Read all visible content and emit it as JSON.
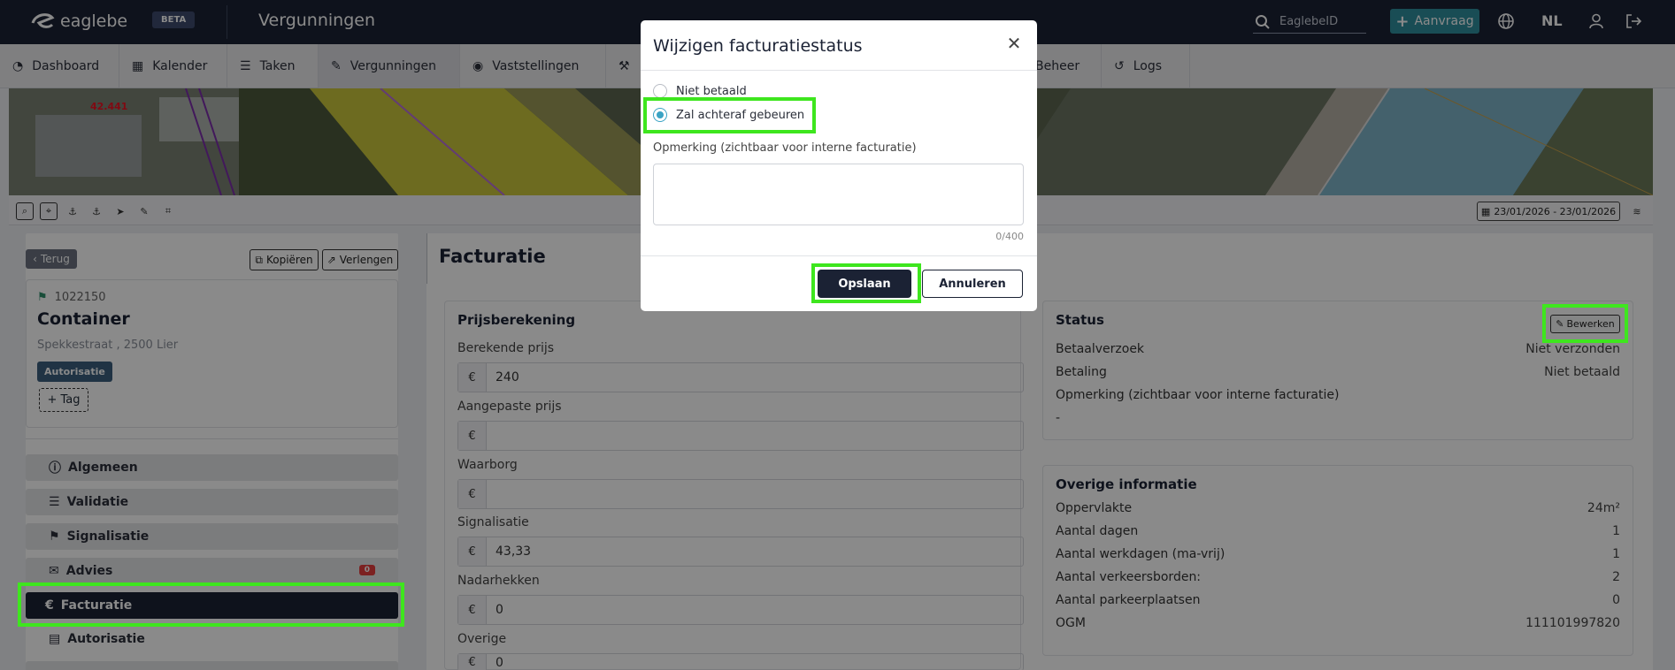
{
  "app": {
    "logo": "eaglebe",
    "beta": "BETA",
    "title": "Vergunningen"
  },
  "topbar": {
    "search_placeholder": "EaglebeID",
    "aanvraag_label": "Aanvraag",
    "language": "NL"
  },
  "nav": [
    {
      "label": "Dashboard"
    },
    {
      "label": "Kalender"
    },
    {
      "label": "Taken"
    },
    {
      "label": "Vergunningen"
    },
    {
      "label": "Vaststellingen"
    },
    {
      "label": "Beheer"
    },
    {
      "label": "Logs"
    }
  ],
  "map": {
    "label_speed": "42.441",
    "date_range": "23/01/2026 - 23/01/2026"
  },
  "left": {
    "back": "Terug",
    "copy": "Kopiëren",
    "extend": "Verlengen",
    "id": "1022150",
    "title": "Container",
    "address": "Spekkestraat , 2500 Lier",
    "badge": "Autorisatie",
    "tag": "+ Tag",
    "menu": [
      {
        "label": "Algemeen",
        "count": ""
      },
      {
        "label": "Validatie",
        "count": ""
      },
      {
        "label": "Signalisatie",
        "count": ""
      },
      {
        "label": "Advies",
        "count": "0"
      },
      {
        "label": "Facturatie",
        "count": ""
      },
      {
        "label": "Autorisatie",
        "count": ""
      }
    ]
  },
  "main": {
    "title": "Facturatie",
    "pricing": {
      "title": "Prijsberekening",
      "currency": "€",
      "fields": [
        {
          "label": "Berekende prijs",
          "value": "240"
        },
        {
          "label": "Aangepaste prijs",
          "value": ""
        },
        {
          "label": "Waarborg",
          "value": ""
        },
        {
          "label": "Signalisatie",
          "value": "43,33"
        },
        {
          "label": "Nadarhekken",
          "value": "0"
        },
        {
          "label": "Overige",
          "value": "0"
        }
      ]
    },
    "status": {
      "title": "Status",
      "edit": "Bewerken",
      "rows": [
        {
          "label": "Betaalverzoek",
          "value": "Niet verzonden"
        },
        {
          "label": "Betaling",
          "value": "Niet betaald"
        }
      ],
      "remark_label": "Opmerking (zichtbaar voor interne facturatie)",
      "remark_value": "-"
    },
    "info": {
      "title": "Overige informatie",
      "rows": [
        {
          "label": "Oppervlakte",
          "value": "24m²"
        },
        {
          "label": "Aantal dagen",
          "value": "1"
        },
        {
          "label": "Aantal werkdagen (ma-vrij)",
          "value": "1"
        },
        {
          "label": "Aantal verkeersborden:",
          "value": "2"
        },
        {
          "label": "Aantal parkeerplaatsen",
          "value": "0"
        },
        {
          "label": "OGM",
          "value": "111101997820"
        }
      ]
    }
  },
  "modal": {
    "title": "Wijzigen facturatiestatus",
    "options": [
      {
        "label": "Niet betaald",
        "selected": false
      },
      {
        "label": "Zal achteraf gebeuren",
        "selected": true
      }
    ],
    "remark_label": "Opmerking (zichtbaar voor interne facturatie)",
    "remark_value": "",
    "counter": "0/400",
    "save": "Opslaan",
    "cancel": "Annuleren"
  },
  "colors": {
    "navy": "#1b2234",
    "teal": "#2f8f9d",
    "highlight": "#3ee61e",
    "radio": "#3aa3c4"
  }
}
